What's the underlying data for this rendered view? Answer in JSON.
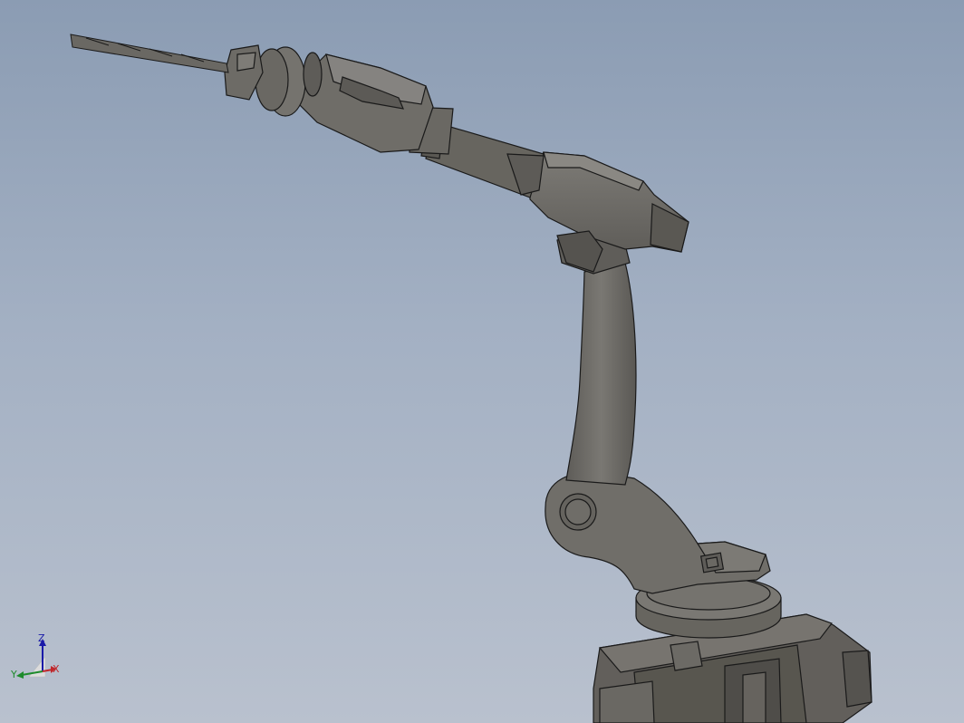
{
  "viewport": {
    "background_top": "#8b9cb3",
    "background_bottom": "#b9c1ce"
  },
  "model": {
    "name_icon": "robot-arm-model",
    "body_color": "#6f6d68",
    "edge_color": "#1a1a1a"
  },
  "triad": {
    "z_label": "Z",
    "y_label": "Y",
    "x_label": "X",
    "z_color": "#1a1aa8",
    "y_color": "#1e8b2c",
    "x_color": "#c0282c"
  }
}
